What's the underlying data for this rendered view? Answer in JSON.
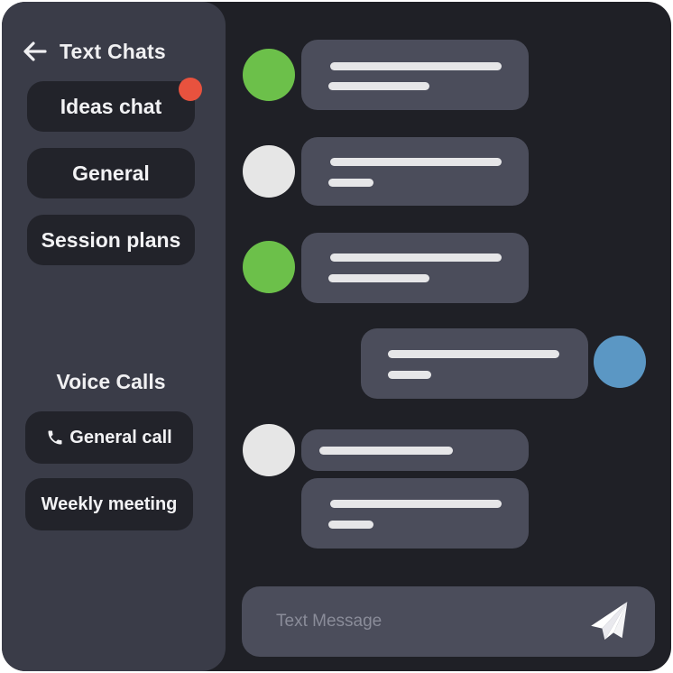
{
  "sidebar": {
    "text_chats_title": "Text Chats",
    "channels": [
      {
        "label": "Ideas chat",
        "unread": true
      },
      {
        "label": "General",
        "unread": false
      },
      {
        "label": "Session plans",
        "unread": false
      }
    ],
    "voice_title": "Voice Calls",
    "calls": [
      {
        "label": "General call",
        "icon": "phone-icon"
      },
      {
        "label": "Weekly meeting"
      }
    ]
  },
  "colors": {
    "app_bg": "#1f2026",
    "sidebar_bg": "#3a3c48",
    "button_bg": "#22232a",
    "bubble_bg": "#4b4d5b",
    "unread": "#e8523e",
    "avatar_green": "#6cc04a",
    "avatar_gray": "#e6e6e6",
    "avatar_blue": "#5b97c4"
  },
  "composer": {
    "placeholder": "Text Message",
    "value": "",
    "send_icon": "paper-plane-icon"
  }
}
